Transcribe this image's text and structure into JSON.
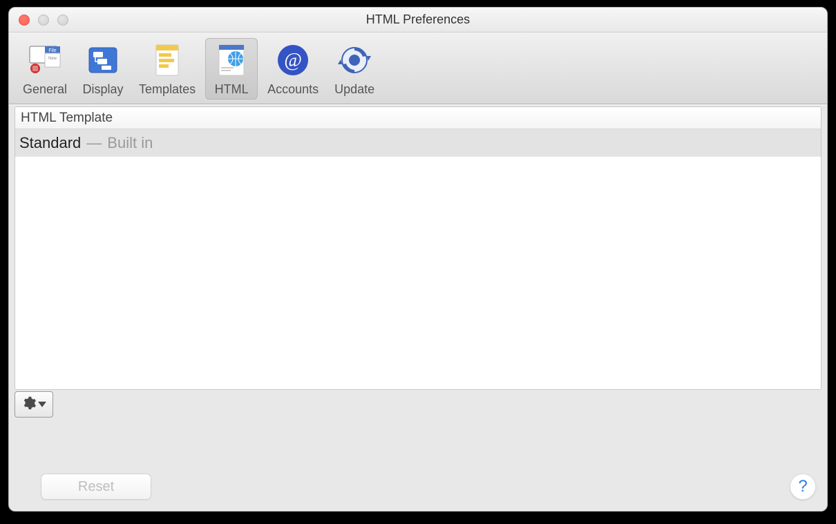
{
  "window": {
    "title": "HTML Preferences"
  },
  "toolbar": {
    "items": [
      {
        "id": "general",
        "label": "General"
      },
      {
        "id": "display",
        "label": "Display"
      },
      {
        "id": "templates",
        "label": "Templates"
      },
      {
        "id": "html",
        "label": "HTML",
        "selected": true
      },
      {
        "id": "accounts",
        "label": "Accounts"
      },
      {
        "id": "update",
        "label": "Update"
      }
    ]
  },
  "list": {
    "header": "HTML Template",
    "rows": [
      {
        "name": "Standard",
        "separator": "—",
        "meta": "Built in"
      }
    ]
  },
  "footer": {
    "reset_label": "Reset",
    "help_label": "?"
  },
  "icons": {
    "gear": "gear-icon",
    "caret": "caret-down-icon"
  }
}
